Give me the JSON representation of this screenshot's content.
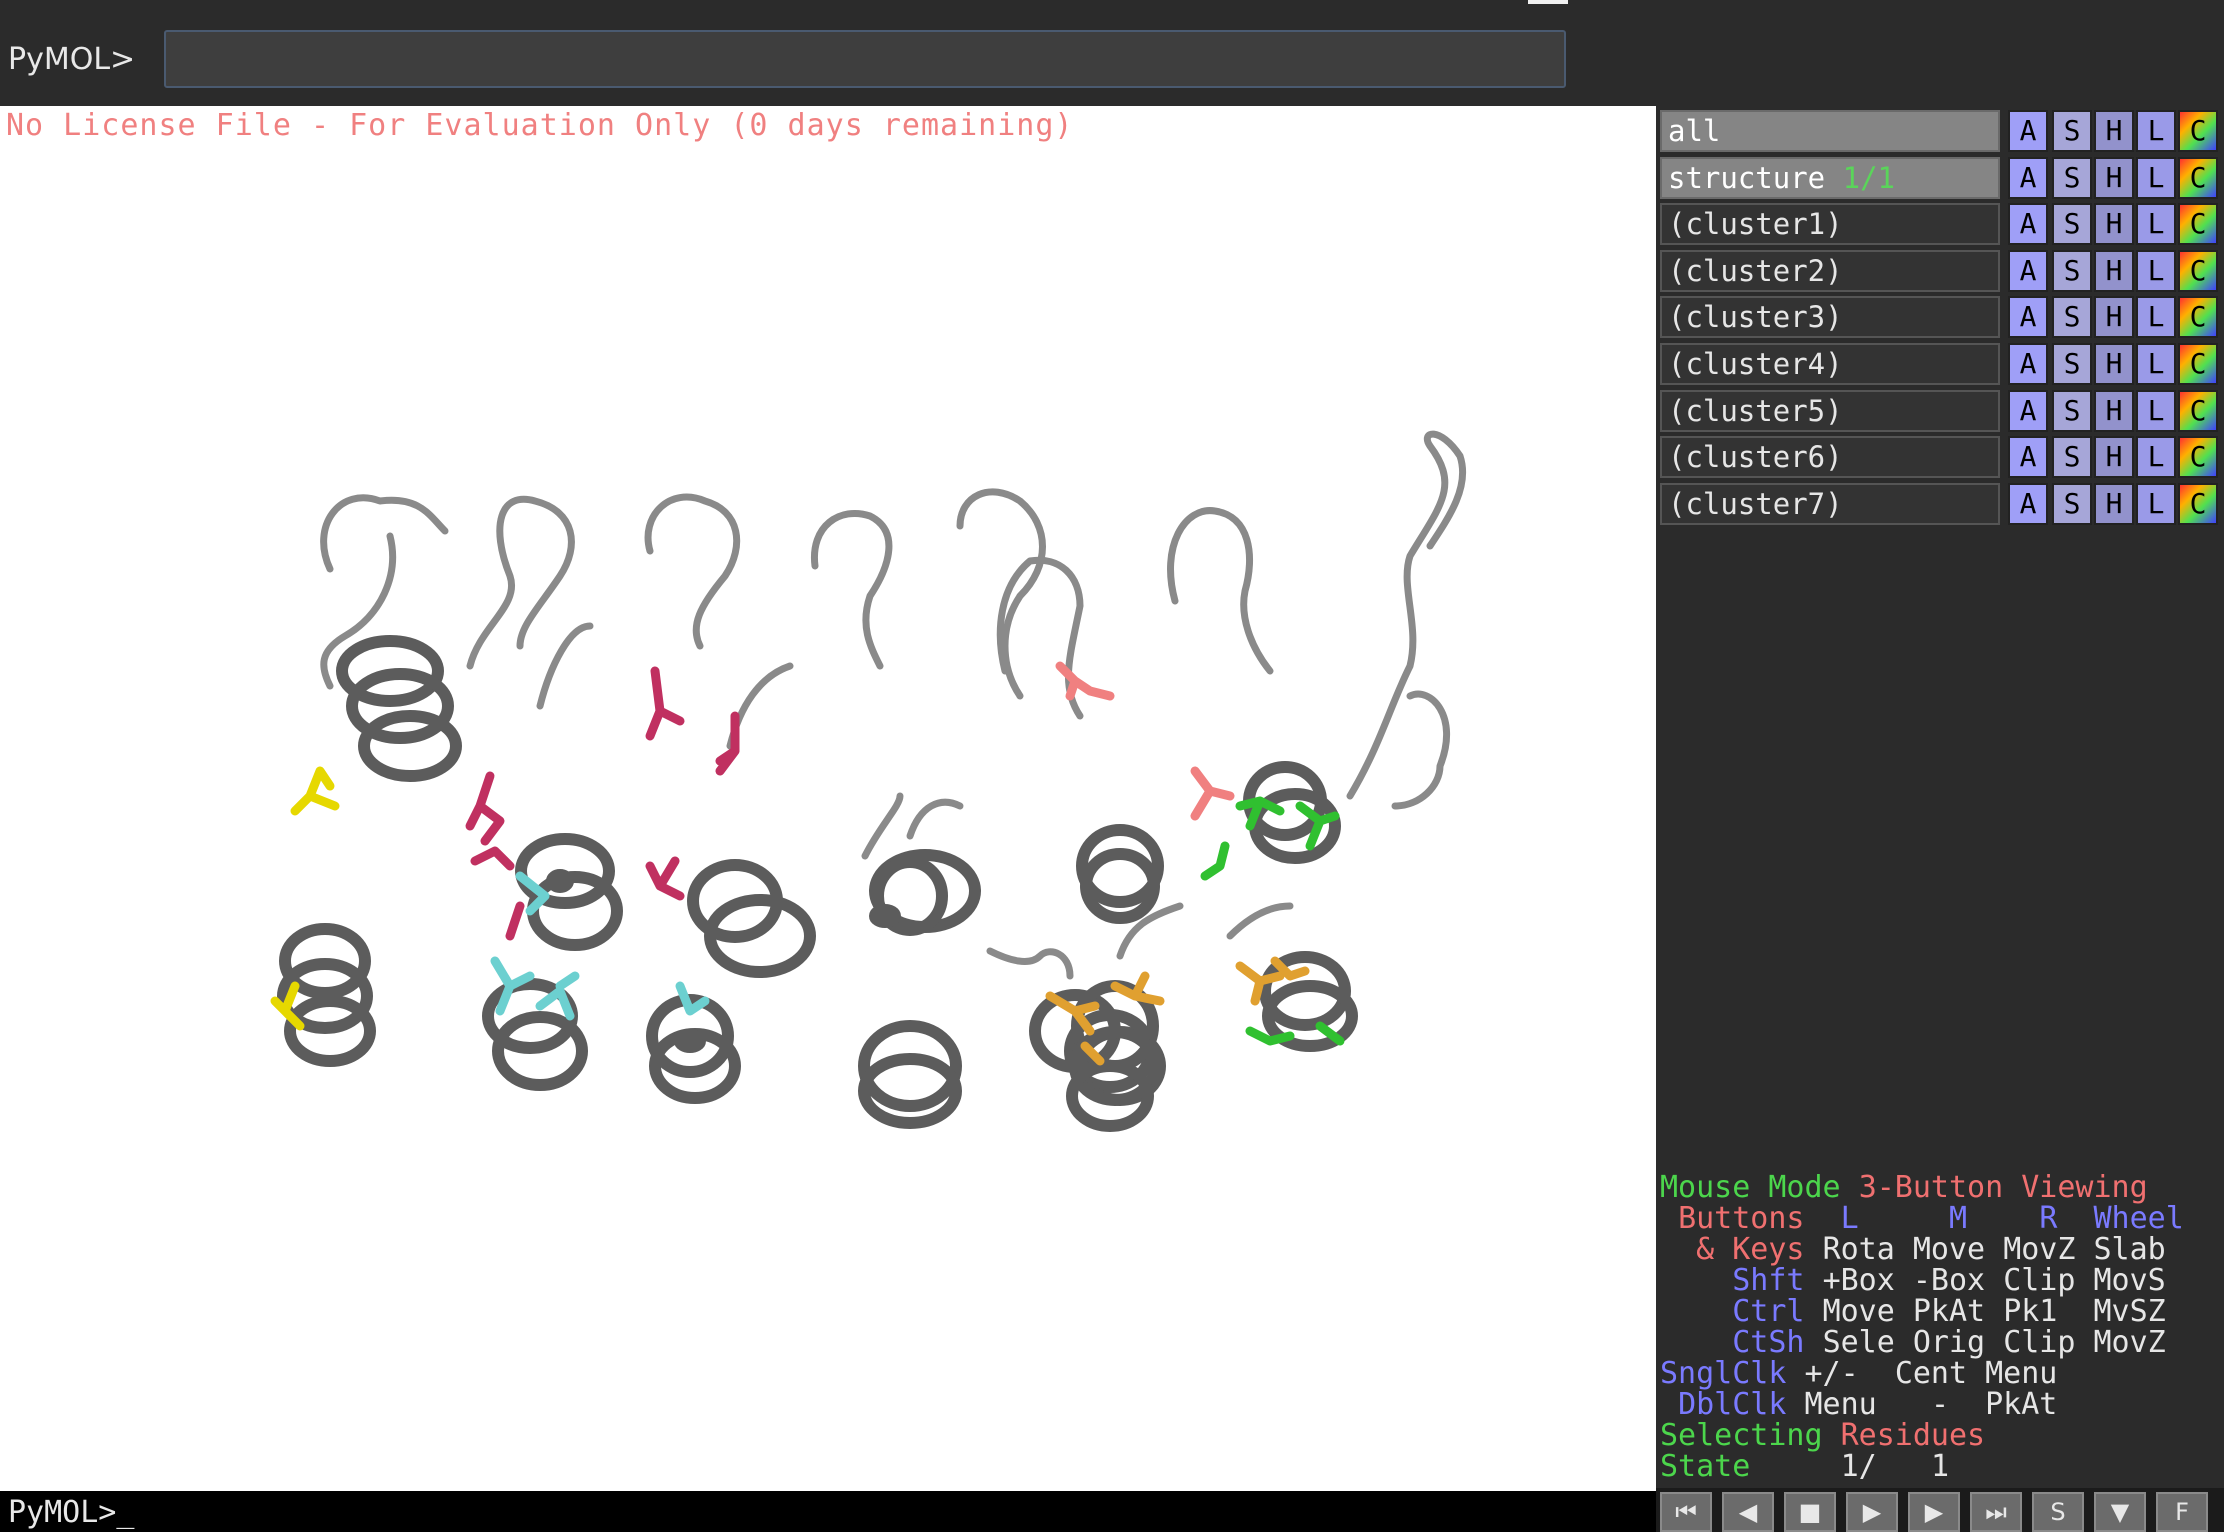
{
  "command": {
    "prompt": "PyMOL>",
    "input_value": ""
  },
  "viewer": {
    "license_notice": "No License File - For Evaluation Only (0 days remaining)",
    "background": "#ffffff"
  },
  "bottom_line": {
    "prompt": "PyMOL>_"
  },
  "objects": [
    {
      "name": "all",
      "state": "",
      "selected": true
    },
    {
      "name": "structure",
      "state": "1/1",
      "selected": true
    },
    {
      "name": "(cluster1)",
      "state": "",
      "selected": false
    },
    {
      "name": "(cluster2)",
      "state": "",
      "selected": false
    },
    {
      "name": "(cluster3)",
      "state": "",
      "selected": false
    },
    {
      "name": "(cluster4)",
      "state": "",
      "selected": false
    },
    {
      "name": "(cluster5)",
      "state": "",
      "selected": false
    },
    {
      "name": "(cluster6)",
      "state": "",
      "selected": false
    },
    {
      "name": "(cluster7)",
      "state": "",
      "selected": false
    }
  ],
  "object_buttons": {
    "action": "A",
    "show": "S",
    "hide": "H",
    "label": "L",
    "color": "C"
  },
  "mouse_mode": {
    "title_left": "Mouse Mode",
    "title_right": "3-Button Viewing",
    "buttons_label": "Buttons",
    "col_l": "L",
    "col_m": "M",
    "col_r": "R",
    "col_wheel": "Wheel",
    "keys_label": "& Keys",
    "row_keys": [
      "Rota",
      "Move",
      "MovZ",
      "Slab"
    ],
    "shft_label": "Shft",
    "row_shft": [
      "+Box",
      "-Box",
      "Clip",
      "MovS"
    ],
    "ctrl_label": "Ctrl",
    "row_ctrl": [
      "Move",
      "PkAt",
      "Pk1",
      "MvSZ"
    ],
    "ctsh_label": "CtSh",
    "row_ctsh": [
      "Sele",
      "Orig",
      "Clip",
      "MovZ"
    ],
    "sngl_label": "SnglClk",
    "row_sngl": [
      "+/-",
      "Cent",
      "Menu"
    ],
    "dbl_label": "DblClk",
    "row_dbl": [
      "Menu",
      "-",
      "PkAt"
    ],
    "selecting_label": "Selecting",
    "selecting_value": "Residues",
    "state_label": "State",
    "state_value": "1/",
    "state_total": "1"
  },
  "movie_controls": [
    "⏮",
    "◀",
    "■",
    "▶",
    "▶",
    "⏭",
    "S",
    "▼",
    "F"
  ],
  "colors": {
    "helix_gray": "#5c5c5c",
    "loop_gray": "#8a8a8a",
    "yellow": "#e6d800",
    "magenta": "#c03060",
    "cyan": "#6cd0d0",
    "salmon": "#f08080",
    "green": "#30c030",
    "orange": "#e0a030"
  }
}
